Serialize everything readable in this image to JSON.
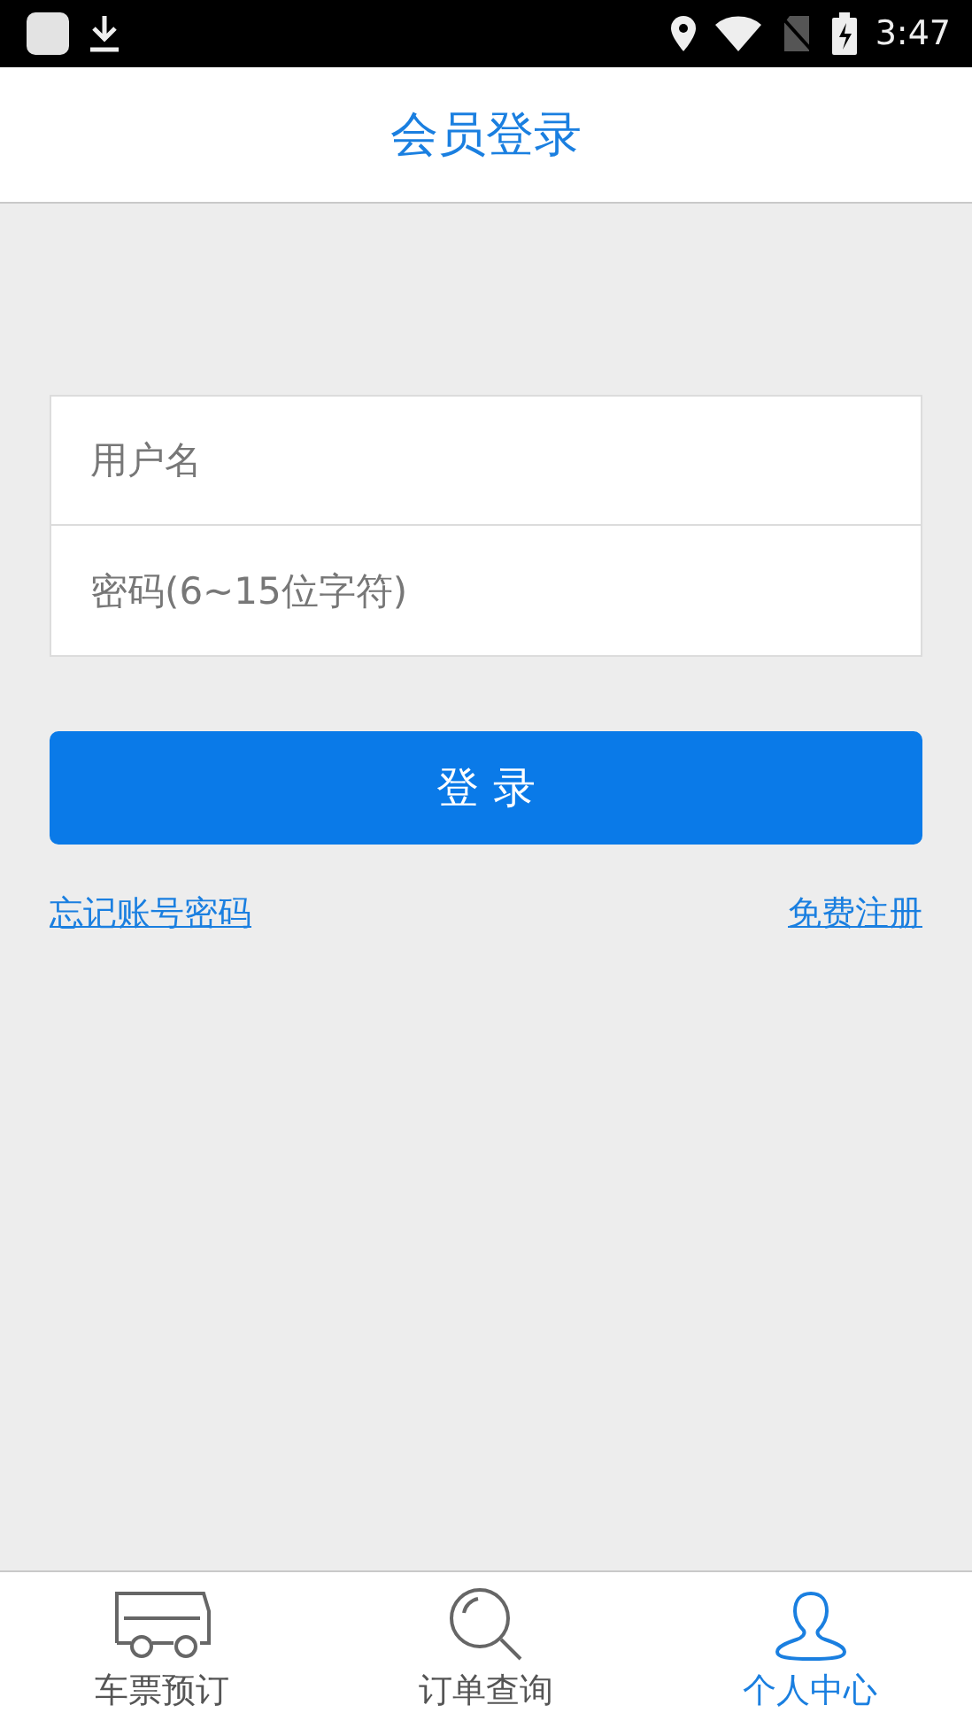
{
  "status_bar": {
    "time": "3:47"
  },
  "header": {
    "title": "会员登录"
  },
  "form": {
    "fields": [
      {
        "placeholder": "用户名"
      },
      {
        "placeholder": "密码(6~15位字符)"
      }
    ],
    "submit": "登 录",
    "links": [
      "忘记账号密码",
      "免费注册"
    ]
  },
  "tabs": [
    {
      "kind": "bus",
      "label": "车票预订",
      "selected": false
    },
    {
      "kind": "search",
      "label": "订单查询",
      "selected": false
    },
    {
      "kind": "person",
      "label": "个人中心",
      "selected": true
    }
  ]
}
